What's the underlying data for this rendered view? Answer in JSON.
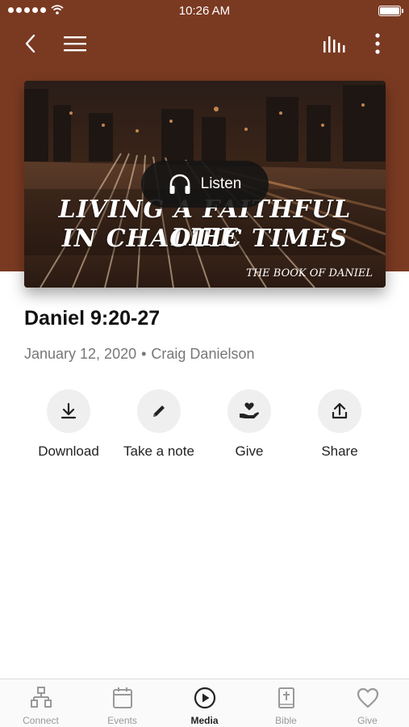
{
  "status_bar": {
    "time": "10:26 AM"
  },
  "nav": {
    "back_icon": "chevron-left-icon",
    "menu_icon": "hamburger-icon",
    "audio_icon": "equalizer-icon",
    "more_icon": "more-vertical-icon"
  },
  "cover": {
    "line1": "LIVING A FAITHFUL LIFE",
    "line2": "IN CHAOTIC TIMES",
    "series": "THE BOOK OF DANIEL",
    "listen_label": "Listen"
  },
  "sermon": {
    "title": "Daniel 9:20-27",
    "date": "January 12, 2020",
    "separator": "•",
    "speaker": "Craig Danielson"
  },
  "actions": [
    {
      "label": "Download",
      "icon": "download-icon"
    },
    {
      "label": "Take a note",
      "icon": "pencil-icon"
    },
    {
      "label": "Give",
      "icon": "hand-heart-icon"
    },
    {
      "label": "Share",
      "icon": "share-icon"
    }
  ],
  "tabs": [
    {
      "label": "Connect",
      "icon": "connect-icon",
      "active": false
    },
    {
      "label": "Events",
      "icon": "calendar-icon",
      "active": false
    },
    {
      "label": "Media",
      "icon": "play-circle-icon",
      "active": true
    },
    {
      "label": "Bible",
      "icon": "bible-icon",
      "active": false
    },
    {
      "label": "Give",
      "icon": "heart-icon",
      "active": false
    }
  ],
  "colors": {
    "header": "#7a3a22",
    "active_tab": "#222222",
    "inactive_tab": "#999999"
  }
}
